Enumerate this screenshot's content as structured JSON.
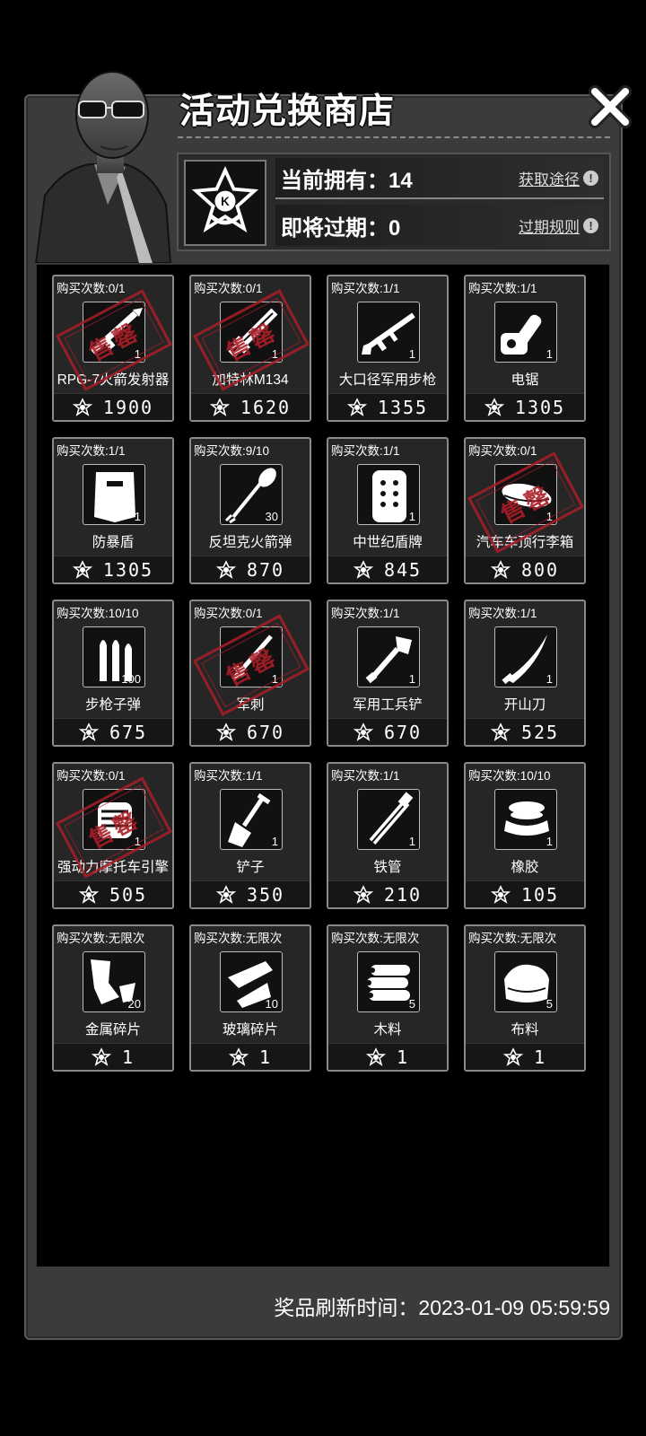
{
  "header": {
    "title": "活动兑换商店",
    "close_icon": "close-x-icon"
  },
  "currency": {
    "owned_label": "当前拥有：14",
    "obtain_link": "获取途径",
    "expiring_label": "即将过期：0",
    "expire_rule_link": "过期规则"
  },
  "items": [
    {
      "limit": "购买次数:0/1",
      "name": "RPG-7火箭发射器",
      "qty": "1",
      "price": "1900",
      "icon": "rocket-launcher-icon",
      "sold_out": true
    },
    {
      "limit": "购买次数:0/1",
      "name": "加特林M134",
      "qty": "1",
      "price": "1620",
      "icon": "minigun-icon",
      "sold_out": true
    },
    {
      "limit": "购买次数:1/1",
      "name": "大口径军用步枪",
      "qty": "1",
      "price": "1355",
      "icon": "rifle-icon",
      "sold_out": false
    },
    {
      "limit": "购买次数:1/1",
      "name": "电锯",
      "qty": "1",
      "price": "1305",
      "icon": "chainsaw-icon",
      "sold_out": false
    },
    {
      "limit": "购买次数:1/1",
      "name": "防暴盾",
      "qty": "1",
      "price": "1305",
      "icon": "riot-shield-icon",
      "sold_out": false
    },
    {
      "limit": "购买次数:9/10",
      "name": "反坦克火箭弹",
      "qty": "30",
      "price": "870",
      "icon": "rocket-ammo-icon",
      "sold_out": false
    },
    {
      "limit": "购买次数:1/1",
      "name": "中世纪盾牌",
      "qty": "1",
      "price": "845",
      "icon": "medieval-shield-icon",
      "sold_out": false
    },
    {
      "limit": "购买次数:0/1",
      "name": "汽车车顶行李箱",
      "qty": "1",
      "price": "800",
      "icon": "roof-box-icon",
      "sold_out": true
    },
    {
      "limit": "购买次数:10/10",
      "name": "步枪子弹",
      "qty": "100",
      "price": "675",
      "icon": "bullets-icon",
      "sold_out": false
    },
    {
      "limit": "购买次数:0/1",
      "name": "军刺",
      "qty": "1",
      "price": "670",
      "icon": "bayonet-icon",
      "sold_out": true
    },
    {
      "limit": "购买次数:1/1",
      "name": "军用工兵铲",
      "qty": "1",
      "price": "670",
      "icon": "entrenching-tool-icon",
      "sold_out": false
    },
    {
      "limit": "购买次数:1/1",
      "name": "开山刀",
      "qty": "1",
      "price": "525",
      "icon": "machete-icon",
      "sold_out": false
    },
    {
      "limit": "购买次数:0/1",
      "name": "强动力摩托车引擎",
      "qty": "1",
      "price": "505",
      "icon": "engine-icon",
      "sold_out": true
    },
    {
      "limit": "购买次数:1/1",
      "name": "铲子",
      "qty": "1",
      "price": "350",
      "icon": "shovel-icon",
      "sold_out": false
    },
    {
      "limit": "购买次数:1/1",
      "name": "铁管",
      "qty": "1",
      "price": "210",
      "icon": "iron-pipe-icon",
      "sold_out": false
    },
    {
      "limit": "购买次数:10/10",
      "name": "橡胶",
      "qty": "1",
      "price": "105",
      "icon": "rubber-icon",
      "sold_out": false
    },
    {
      "limit": "购买次数:无限次",
      "name": "金属碎片",
      "qty": "20",
      "price": "1",
      "icon": "metal-scrap-icon",
      "sold_out": false
    },
    {
      "limit": "购买次数:无限次",
      "name": "玻璃碎片",
      "qty": "10",
      "price": "1",
      "icon": "glass-shard-icon",
      "sold_out": false
    },
    {
      "limit": "购买次数:无限次",
      "name": "木料",
      "qty": "5",
      "price": "1",
      "icon": "wood-logs-icon",
      "sold_out": false
    },
    {
      "limit": "购买次数:无限次",
      "name": "布料",
      "qty": "5",
      "price": "1",
      "icon": "cloth-icon",
      "sold_out": false
    }
  ],
  "stamp_text": "售罄",
  "footer": {
    "refresh_text": "奖品刷新时间：2023-01-09 05:59:59"
  },
  "colors": {
    "panel": "#3b3b3b",
    "card": "#262626",
    "stamp": "#aa1e28"
  }
}
